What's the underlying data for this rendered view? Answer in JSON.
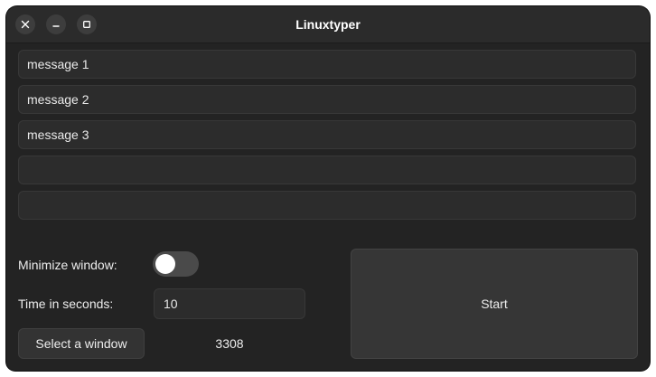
{
  "window": {
    "title": "Linuxtyper",
    "controls": {
      "close_icon": "close-icon",
      "minimize_icon": "minimize-icon",
      "maximize_icon": "maximize-icon"
    }
  },
  "messages": [
    {
      "value": "message 1"
    },
    {
      "value": "message 2"
    },
    {
      "value": "message 3"
    },
    {
      "value": ""
    },
    {
      "value": ""
    }
  ],
  "options": {
    "minimize_label": "Minimize window:",
    "minimize_enabled": false,
    "time_label": "Time in seconds:",
    "time_value": "10"
  },
  "actions": {
    "select_window_label": "Select a window",
    "window_id": "3308",
    "start_label": "Start"
  },
  "colors": {
    "window_bg": "#232323",
    "titlebar_bg": "#2b2b2b",
    "entry_bg": "#2c2c2c",
    "button_bg": "#363636",
    "text": "#ededed"
  }
}
